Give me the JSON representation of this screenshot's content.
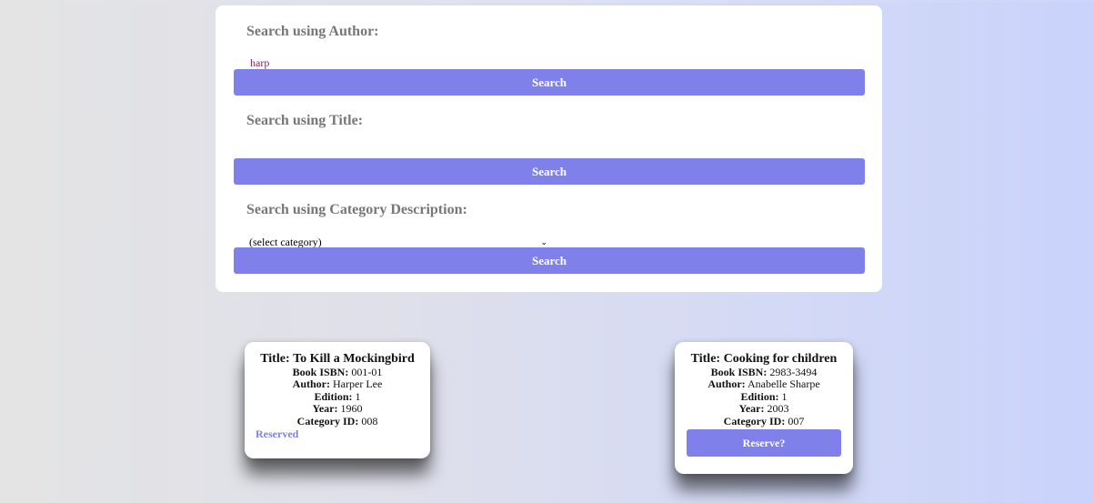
{
  "search": {
    "author": {
      "label": "Search using Author:",
      "value": "harp",
      "button_label": "Search"
    },
    "title": {
      "label": "Search using Title:",
      "value": "",
      "button_label": "Search"
    },
    "category": {
      "label": "Search using Category Description:",
      "selected": "(select category)",
      "button_label": "Search"
    }
  },
  "results": [
    {
      "title_label": "Title:",
      "title": "To Kill a Mockingbird",
      "isbn_label": "Book ISBN:",
      "isbn": "001-01",
      "author_label": "Author:",
      "author": "Harper Lee",
      "edition_label": "Edition:",
      "edition": "1",
      "year_label": "Year:",
      "year": "1960",
      "category_label": "Category ID:",
      "category_id": "008",
      "status": "Reserved"
    },
    {
      "title_label": "Title:",
      "title": "Cooking for children",
      "isbn_label": "Book ISBN:",
      "isbn": "2983-3494",
      "author_label": "Author:",
      "author": "Anabelle Sharpe",
      "edition_label": "Edition:",
      "edition": "1",
      "year_label": "Year:",
      "year": "2003",
      "category_label": "Category ID:",
      "category_id": "007",
      "action": "Reserve?"
    }
  ],
  "colors": {
    "accent": "#7f80ea",
    "label_gray": "#777777",
    "input_text": "#8a1f6b"
  },
  "icons": {
    "select_chevron": "chevron-down-icon"
  }
}
